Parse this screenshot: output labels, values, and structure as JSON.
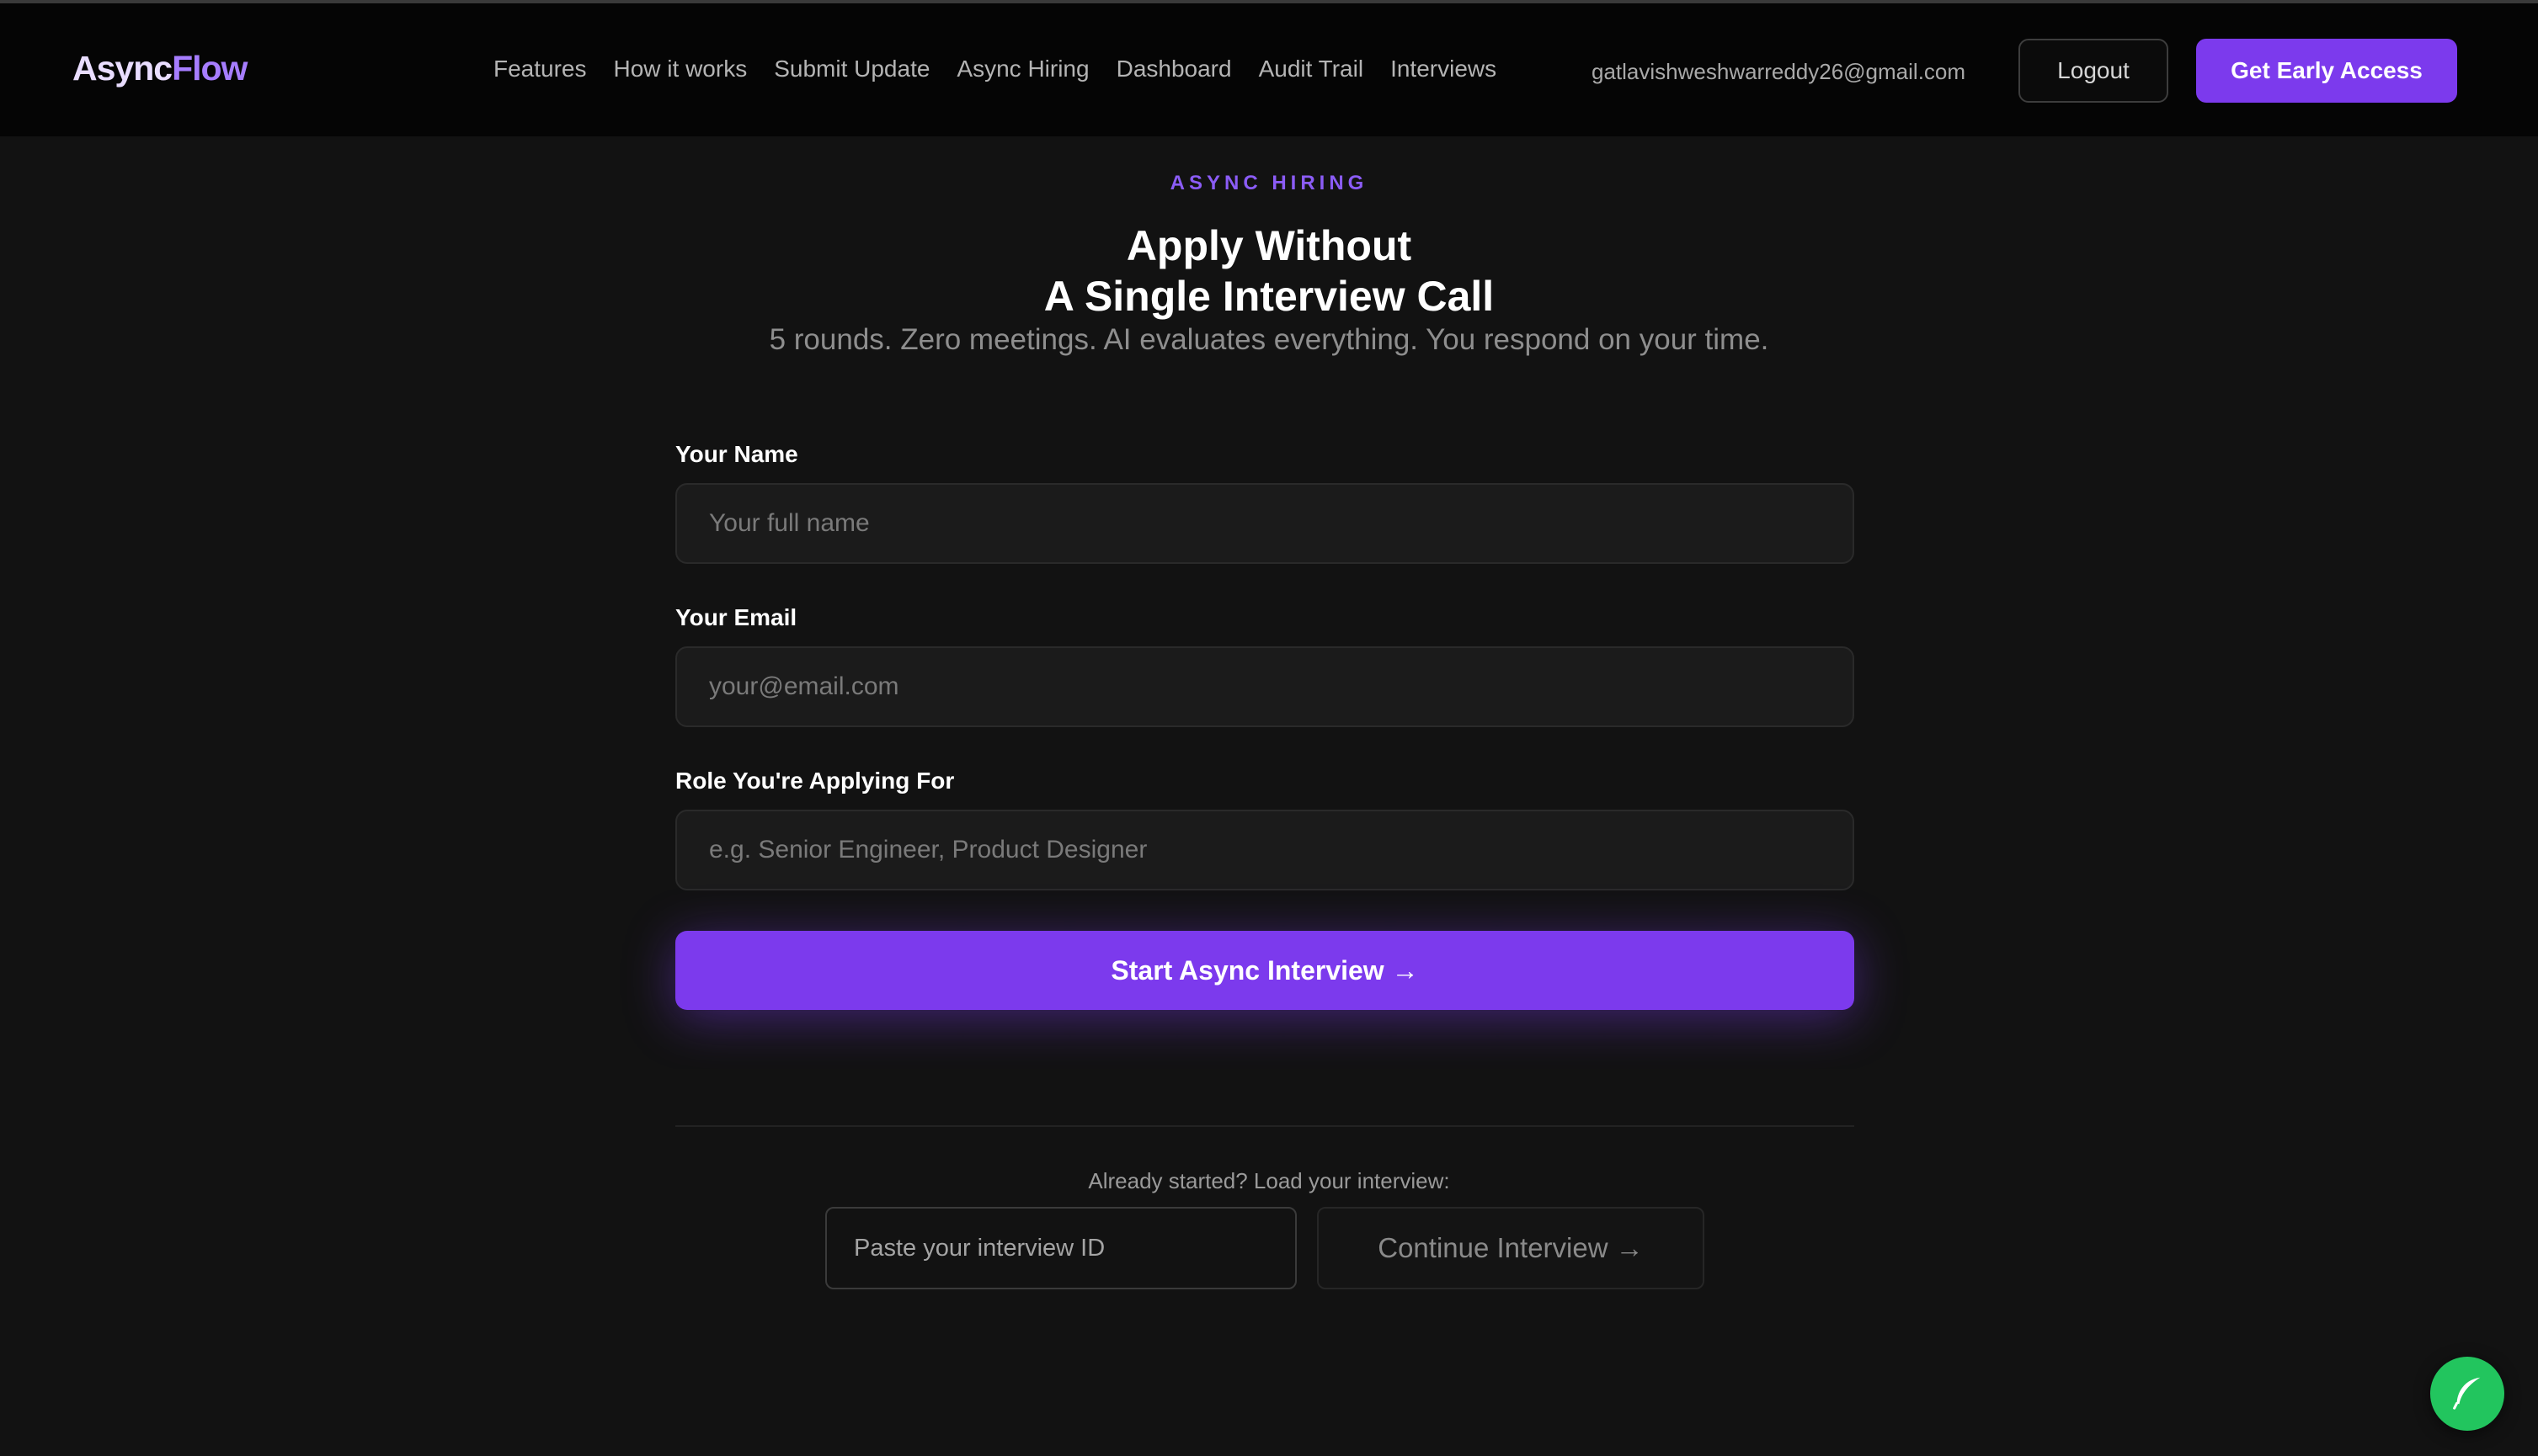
{
  "brand": {
    "part1": "Async",
    "part2": "Flow"
  },
  "nav": {
    "links": [
      "Features",
      "How it works",
      "Submit Update",
      "Async Hiring",
      "Dashboard",
      "Audit Trail",
      "Interviews"
    ],
    "email": "gatlavishweshwarreddy26@gmail.com",
    "logout": "Logout",
    "early_access": "Get Early Access"
  },
  "hero": {
    "eyebrow": "ASYNC HIRING",
    "title_line1": "Apply Without",
    "title_line2": "A Single Interview Call",
    "subtitle": "5 rounds. Zero meetings. AI evaluates everything. You respond on your time."
  },
  "form": {
    "name_label": "Your Name",
    "name_placeholder": "Your full name",
    "email_label": "Your Email",
    "email_placeholder": "your@email.com",
    "role_label": "Role You're Applying For",
    "role_placeholder": "e.g. Senior Engineer, Product Designer",
    "submit": "Start Async Interview →"
  },
  "resume": {
    "prompt": "Already started? Load your interview:",
    "id_placeholder": "Paste your interview ID",
    "continue": "Continue Interview →"
  },
  "colors": {
    "accent": "#7c3aed",
    "background": "#121212",
    "fab": "#22c55e"
  },
  "icons": {
    "fab": "feather-icon"
  }
}
